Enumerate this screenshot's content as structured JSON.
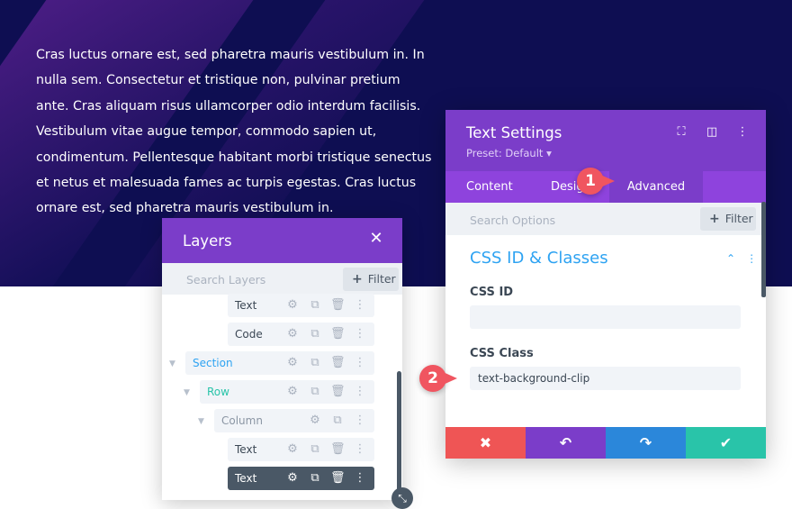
{
  "hero": {
    "paragraph": "Cras luctus ornare est, sed pharetra mauris vestibulum in. In nulla sem. Consectetur et tristique non, pulvinar pretium ante. Cras aliquam risus ullamcorper odio interdum facilisis. Vestibulum vitae augue tempor, commodo sapien ut, condimentum. Pellentesque habitant morbi tristique senectus et netus et malesuada fames ac turpis egestas. Cras luctus ornare est, sed pharetra mauris vestibulum in."
  },
  "layers": {
    "title": "Layers",
    "close_icon": "✕",
    "search_placeholder": "Search Layers",
    "filter_label": "Filter",
    "items": [
      {
        "label": "Text",
        "type": "module"
      },
      {
        "label": "Code",
        "type": "module"
      },
      {
        "label": "Section",
        "type": "section"
      },
      {
        "label": "Row",
        "type": "row"
      },
      {
        "label": "Column",
        "type": "column"
      },
      {
        "label": "Text",
        "type": "module"
      },
      {
        "label": "Text",
        "type": "module",
        "active": true
      }
    ]
  },
  "settings": {
    "title": "Text Settings",
    "preset": "Preset: Default ▾",
    "tabs": [
      "Content",
      "Design",
      "Advanced"
    ],
    "active_tab": "Advanced",
    "search_placeholder": "Search Options",
    "filter_label": "Filter",
    "section_title": "CSS ID & Classes",
    "css_id_label": "CSS ID",
    "css_id_value": "",
    "css_class_label": "CSS Class",
    "css_class_value": "text-background-clip",
    "footer_buttons": [
      {
        "name": "cancel",
        "icon": "✖",
        "color": "#ef5555"
      },
      {
        "name": "undo",
        "icon": "↶",
        "color": "#7b3dc9"
      },
      {
        "name": "redo",
        "icon": "↷",
        "color": "#2b87da"
      },
      {
        "name": "save",
        "icon": "✔",
        "color": "#29c4a9"
      }
    ]
  },
  "callouts": {
    "one": "1",
    "two": "2"
  },
  "colors": {
    "purple_header": "#7b3dc9",
    "tab_bar": "#8e43dd",
    "section_blue": "#2ea3f2",
    "section_green": "#29c4a9",
    "hero_bg": "#0e0e52",
    "badge": "#f05560"
  }
}
